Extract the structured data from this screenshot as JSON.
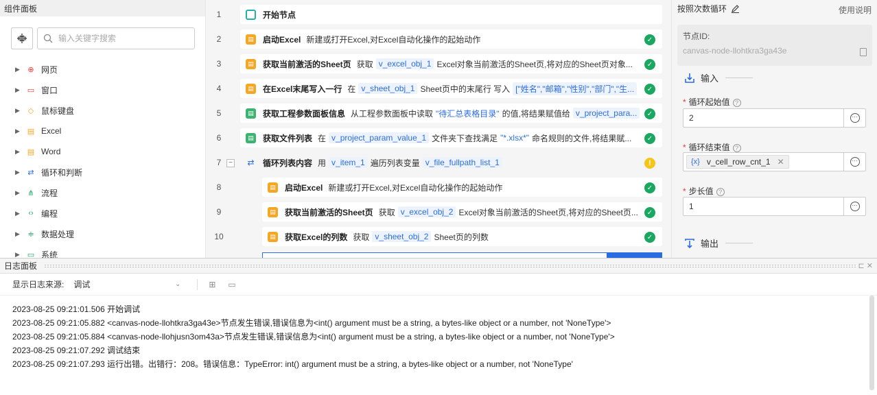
{
  "left": {
    "title": "组件面板",
    "search_placeholder": "输入关键字搜索",
    "items": [
      {
        "label": "网页",
        "icon": "globe-icon",
        "color": "#e53935"
      },
      {
        "label": "窗口",
        "icon": "window-icon",
        "color": "#e53935"
      },
      {
        "label": "鼠标键盘",
        "icon": "mouse-keyboard-icon",
        "color": "#f5a623"
      },
      {
        "label": "Excel",
        "icon": "excel-icon",
        "color": "#f5a623"
      },
      {
        "label": "Word",
        "icon": "word-icon",
        "color": "#f5a623"
      },
      {
        "label": "循环和判断",
        "icon": "loop-icon",
        "color": "#2b6de0"
      },
      {
        "label": "流程",
        "icon": "flow-icon",
        "color": "#1aa760"
      },
      {
        "label": "编程",
        "icon": "code-icon",
        "color": "#1aa760"
      },
      {
        "label": "数据处理",
        "icon": "data-icon",
        "color": "#1aa760"
      },
      {
        "label": "系统",
        "icon": "monitor-icon",
        "color": "#1aa760"
      }
    ]
  },
  "flow": {
    "rows": [
      {
        "num": "1",
        "title": "开始节点",
        "parts": [],
        "status": "none"
      },
      {
        "num": "2",
        "title": "启动Excel",
        "parts": [
          {
            "k": "t",
            "v": "新建或打开Excel,对Excel自动化操作的起始动作"
          }
        ],
        "status": "ok"
      },
      {
        "num": "3",
        "title": "获取当前激活的Sheet页",
        "parts": [
          {
            "k": "t",
            "v": "获取"
          },
          {
            "k": "v",
            "v": "v_excel_obj_1"
          },
          {
            "k": "t",
            "v": "Excel对象当前激活的Sheet页,将对应的Sheet页对象..."
          }
        ],
        "status": "ok"
      },
      {
        "num": "4",
        "title": "在Excel末尾写入一行",
        "parts": [
          {
            "k": "t",
            "v": "在"
          },
          {
            "k": "v",
            "v": "v_sheet_obj_1"
          },
          {
            "k": "t",
            "v": "Sheet页中的末尾行 写入"
          },
          {
            "k": "v",
            "v": "[\"姓名\",\"邮箱\",\"性别\",\"部门\",\"生..."
          }
        ],
        "status": "ok"
      },
      {
        "num": "5",
        "title": "获取工程参数面板信息",
        "parts": [
          {
            "k": "t",
            "v": "从工程参数面板中读取"
          },
          {
            "k": "s",
            "v": "\"待汇总表格目录\""
          },
          {
            "k": "t",
            "v": "的值,将结果赋值给"
          },
          {
            "k": "v",
            "v": "v_project_para..."
          }
        ],
        "status": "ok"
      },
      {
        "num": "6",
        "title": "获取文件列表",
        "parts": [
          {
            "k": "t",
            "v": "在"
          },
          {
            "k": "v",
            "v": "v_project_param_value_1"
          },
          {
            "k": "t",
            "v": "文件夹下查找满足"
          },
          {
            "k": "s",
            "v": "\"*.xlsx*\""
          },
          {
            "k": "t",
            "v": "命名规则的文件,将结果赋..."
          }
        ],
        "status": "ok"
      },
      {
        "num": "7",
        "title": "循环列表内容",
        "parts": [
          {
            "k": "t",
            "v": "用"
          },
          {
            "k": "v",
            "v": "v_item_1"
          },
          {
            "k": "t",
            "v": "遍历列表变量"
          },
          {
            "k": "v",
            "v": "v_file_fullpath_list_1"
          }
        ],
        "status": "warn"
      },
      {
        "num": "8",
        "title": "启动Excel",
        "parts": [
          {
            "k": "t",
            "v": "新建或打开Excel,对Excel自动化操作的起始动作"
          }
        ],
        "status": "ok"
      },
      {
        "num": "9",
        "title": "获取当前激活的Sheet页",
        "parts": [
          {
            "k": "t",
            "v": "获取"
          },
          {
            "k": "v",
            "v": "v_excel_obj_2"
          },
          {
            "k": "t",
            "v": "Excel对象当前激活的Sheet页,将对应的Sheet页..."
          }
        ],
        "status": "ok"
      },
      {
        "num": "10",
        "title": "获取Excel的列数",
        "parts": [
          {
            "k": "t",
            "v": "获取"
          },
          {
            "k": "v",
            "v": "v_sheet_obj_2"
          },
          {
            "k": "t",
            "v": "Sheet页的列数"
          }
        ],
        "status": "ok"
      }
    ]
  },
  "right": {
    "title": "按照次数循环",
    "help": "使用说明",
    "node_id_label": "节点ID:",
    "node_id": "canvas-node-llohtkra3ga43e",
    "input_section": "输入",
    "output_section": "输出",
    "fields": [
      {
        "label": "循环起始值",
        "value": "2"
      },
      {
        "label": "循环结束值",
        "value": "v_cell_row_cnt_1",
        "var_icon": "{x}"
      },
      {
        "label": "步长值",
        "value": "1"
      }
    ]
  },
  "log": {
    "title": "日志面板",
    "source_label": "显示日志来源:",
    "source_value": "调试",
    "lines": [
      "2023-08-25 09:21:01.506 开始调试",
      "2023-08-25 09:21:05.882 <canvas-node-llohtkra3ga43e>节点发生错误,错误信息为<int() argument must be a string, a bytes-like object or a number, not 'NoneType'>",
      "2023-08-25 09:21:05.884 <canvas-node-llohjusn3om43a>节点发生错误,错误信息为<int() argument must be a string, a bytes-like object or a number, not 'NoneType'>",
      "2023-08-25 09:21:07.292 调试结束",
      "2023-08-25 09:21:07.293 运行出错。出错行：208。错误信息：TypeError: int() argument must be a string, a bytes-like object or a number, not 'NoneType'"
    ]
  }
}
